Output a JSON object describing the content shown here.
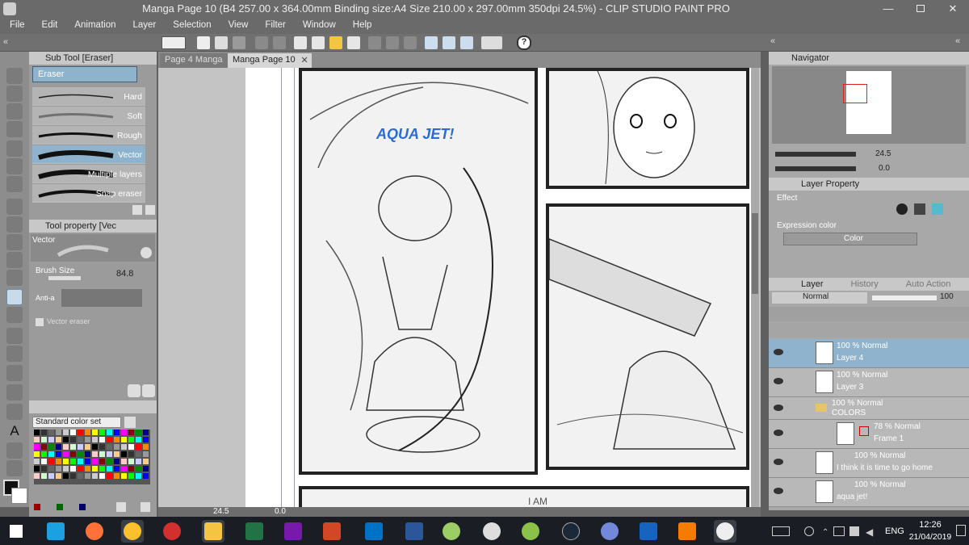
{
  "window": {
    "title": "Manga Page 10 (B4 257.00 x 364.00mm Binding size:A4 Size 210.00 x 297.00mm 350dpi 24.5%)  - CLIP STUDIO PAINT PRO",
    "min": "—",
    "max": "▢",
    "close": "✕"
  },
  "menu": [
    "File",
    "Edit",
    "Animation",
    "Layer",
    "Selection",
    "View",
    "Filter",
    "Window",
    "Help"
  ],
  "subtool": {
    "header": "Sub Tool [Eraser]",
    "group": "Eraser",
    "items": [
      "Hard",
      "Soft",
      "Rough",
      "Vector",
      "Multiple layers",
      "Snap eraser"
    ]
  },
  "toolprop": {
    "header": "Tool property [Vec",
    "name": "Vector",
    "brush_size_label": "Brush Size",
    "brush_size": "84.8",
    "anti_label": "Anti-a",
    "vector_eraser": "Vector eraser"
  },
  "colorset": {
    "title": "Standard color set"
  },
  "tabs": [
    "Page 4 Manga",
    "Manga Page 10"
  ],
  "canvas": {
    "sfx": "AQUA JET!",
    "bottom_text": "I AM"
  },
  "status": {
    "zoom": "24.5",
    "angle": "0.0"
  },
  "navigator": {
    "title": "Navigator",
    "zoom": "24.5",
    "angle": "0.0"
  },
  "layerprop": {
    "title": "Layer Property",
    "effect_label": "Effect",
    "expr_label": "Expression color",
    "expr_value": "Color"
  },
  "layers": {
    "tabs": [
      "Layer",
      "History",
      "Auto Action"
    ],
    "blend": "Normal",
    "opacity": "100",
    "rows": [
      {
        "mode": "100 % Normal",
        "name": "Layer 4"
      },
      {
        "mode": "100 % Normal",
        "name": "Layer 3"
      },
      {
        "mode": "100 % Normal",
        "name": "COLORS"
      },
      {
        "mode": "78 % Normal",
        "name": "Frame 1"
      },
      {
        "mode": "100 % Normal",
        "name": "I think it is time to go home"
      },
      {
        "mode": "100 % Normal",
        "name": "aqua jet!"
      }
    ]
  },
  "taskbar": {
    "lang": "ENG",
    "time": "12:26",
    "date": "21/04/2019"
  },
  "colors": {
    "accent": "#2a6cd3",
    "selected": "#8fb3cc"
  }
}
